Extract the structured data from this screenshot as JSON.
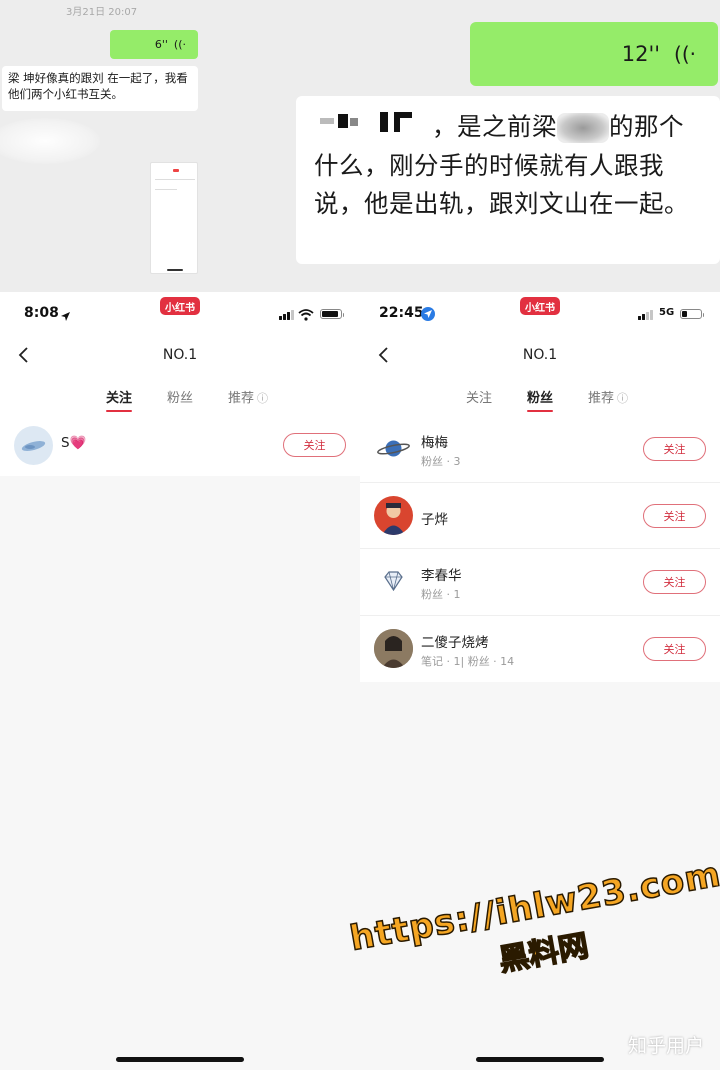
{
  "chat": {
    "timestamp": "3月21日 20:07",
    "voice_short": {
      "duration": "6''",
      "icon": "voice-wave-icon"
    },
    "msg_left": "梁  坤好像真的跟刘  在一起了，我看他们两个小红书互关。",
    "voice_long": {
      "duration": "12''",
      "icon": "voice-wave-icon"
    },
    "msg_right_before_blur": "，是之前梁",
    "msg_right_after_blur": "的那个什么，刚分手的时候就有人跟我说，他是出轨，跟刘文山在一起。"
  },
  "left_phone": {
    "time": "8:08",
    "app_badge": "小红书",
    "title": "NO.1",
    "tabs": [
      {
        "label": "关注",
        "active": true
      },
      {
        "label": "粉丝",
        "active": false
      },
      {
        "label": "推荐",
        "active": false
      }
    ],
    "info_icon": "ⓘ",
    "users": [
      {
        "name": "S💗",
        "follow_label": "关注"
      }
    ]
  },
  "right_phone": {
    "time": "22:45",
    "app_badge": "小红书",
    "network": "5G",
    "title": "NO.1",
    "tabs": [
      {
        "label": "关注",
        "active": false
      },
      {
        "label": "粉丝",
        "active": true
      },
      {
        "label": "推荐",
        "active": false
      }
    ],
    "info_icon": "ⓘ",
    "users": [
      {
        "name": "梅梅",
        "sub": "粉丝 · 3",
        "follow_label": "关注",
        "avatar": "planet-icon"
      },
      {
        "name": "子烨",
        "sub": "",
        "follow_label": "关注",
        "avatar": "person-photo"
      },
      {
        "name": "李春华",
        "sub": "粉丝 · 1",
        "follow_label": "关注",
        "avatar": "diamond-icon"
      },
      {
        "name": "二傻子烧烤",
        "sub": "笔记 · 1| 粉丝 · 14",
        "follow_label": "关注",
        "avatar": "person-photo"
      }
    ]
  },
  "watermark": {
    "url": "https://ihlw23.com",
    "text": "黑料网"
  },
  "credit": "知乎用户",
  "colors": {
    "wechat_green": "#95ec69",
    "xhs_red": "#e23040",
    "watermark_orange": "#f5a623"
  }
}
